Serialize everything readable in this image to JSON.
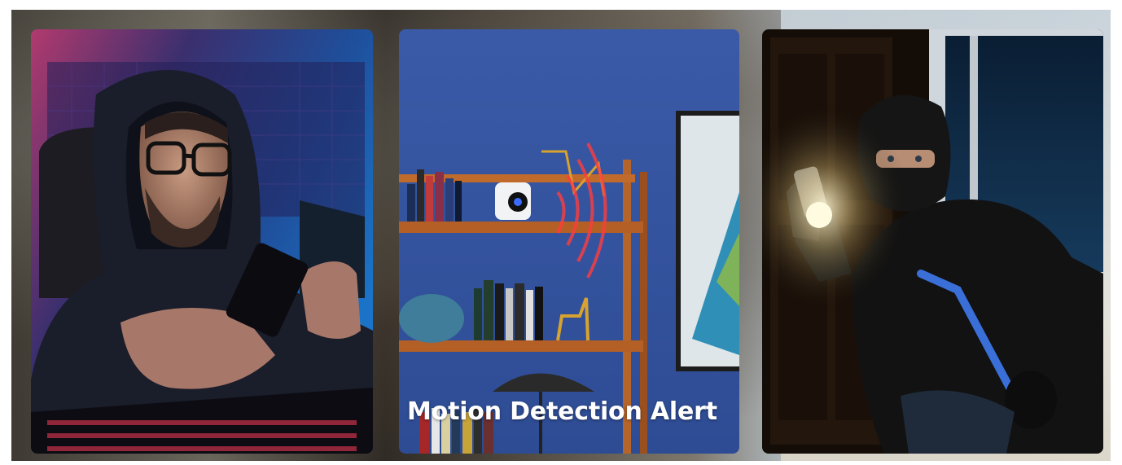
{
  "gallery": {
    "cards": [
      {
        "id": "gamer"
      },
      {
        "id": "motion",
        "caption": "Motion Detection Alert"
      },
      {
        "id": "burglar"
      }
    ]
  }
}
